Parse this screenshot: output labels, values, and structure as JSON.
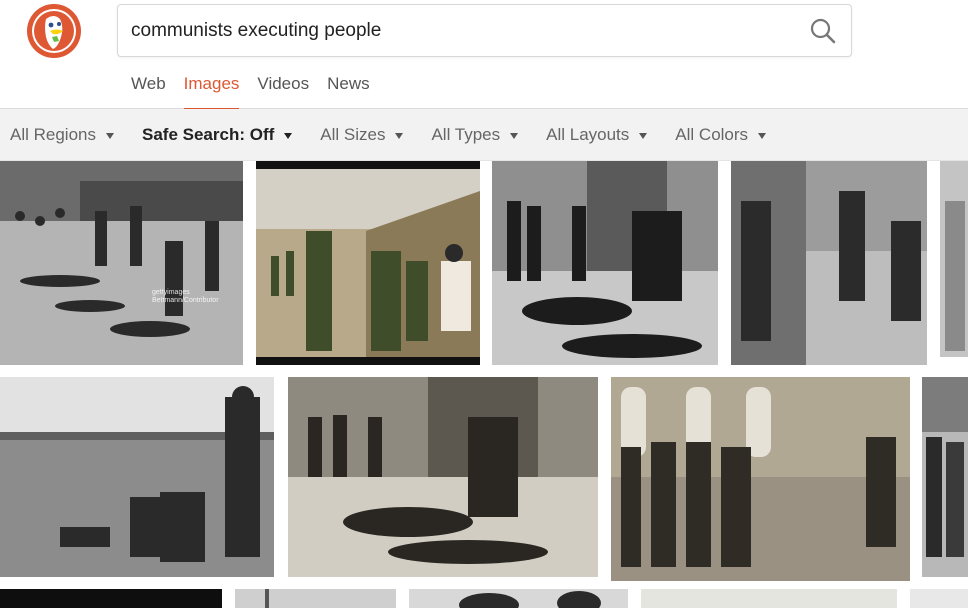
{
  "search": {
    "query": "communists executing people"
  },
  "nav": {
    "tabs": [
      {
        "label": "Web",
        "active": false
      },
      {
        "label": "Images",
        "active": true
      },
      {
        "label": "Videos",
        "active": false
      },
      {
        "label": "News",
        "active": false
      }
    ]
  },
  "filters": [
    {
      "label": "All Regions"
    },
    {
      "label": "Safe Search: Off"
    },
    {
      "label": "All Sizes"
    },
    {
      "label": "All Types"
    },
    {
      "label": "All Layouts"
    },
    {
      "label": "All Colors"
    }
  ],
  "watermark": {
    "line1": "gettyimages",
    "line2": "Bettmann/Contributor"
  },
  "icons": {
    "logo": "duckduckgo-logo-icon",
    "search": "magnifier-icon",
    "caret": "caret-down-icon"
  },
  "colors": {
    "accent": "#de5833",
    "filter_bar": "#f2f2f2",
    "logo_red": "#de5833"
  }
}
